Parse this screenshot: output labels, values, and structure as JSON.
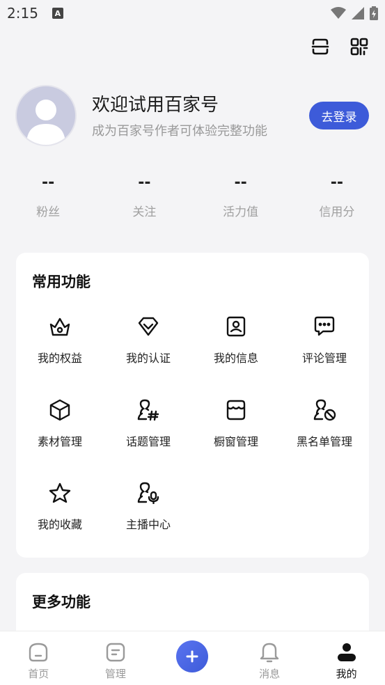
{
  "status_bar": {
    "time": "2:15",
    "notification_icon": "A"
  },
  "top_icons": [
    "scan-icon",
    "qrcode-icon"
  ],
  "profile": {
    "welcome": "欢迎试用百家号",
    "subtitle": "成为百家号作者可体验完整功能",
    "login_label": "去登录"
  },
  "stats": [
    {
      "value": "--",
      "label": "粉丝"
    },
    {
      "value": "--",
      "label": "关注"
    },
    {
      "value": "--",
      "label": "活力值"
    },
    {
      "value": "--",
      "label": "信用分"
    }
  ],
  "common": {
    "title": "常用功能",
    "items": [
      {
        "label": "我的权益",
        "icon": "crown-icon"
      },
      {
        "label": "我的认证",
        "icon": "verify-icon"
      },
      {
        "label": "我的信息",
        "icon": "profile-card-icon"
      },
      {
        "label": "评论管理",
        "icon": "comment-icon"
      },
      {
        "label": "素材管理",
        "icon": "cube-icon"
      },
      {
        "label": "话题管理",
        "icon": "topic-icon"
      },
      {
        "label": "橱窗管理",
        "icon": "shop-icon"
      },
      {
        "label": "黑名单管理",
        "icon": "block-user-icon"
      },
      {
        "label": "我的收藏",
        "icon": "star-icon"
      },
      {
        "label": "主播中心",
        "icon": "anchor-icon"
      }
    ]
  },
  "more": {
    "title": "更多功能"
  },
  "nav": [
    {
      "label": "首页",
      "icon": "home-icon"
    },
    {
      "label": "管理",
      "icon": "manage-icon"
    },
    {
      "label": "",
      "icon": "plus-icon"
    },
    {
      "label": "消息",
      "icon": "bell-icon"
    },
    {
      "label": "我的",
      "icon": "user-icon"
    }
  ],
  "colors": {
    "accent": "#3d5bd9",
    "background": "#f4f4f6"
  }
}
